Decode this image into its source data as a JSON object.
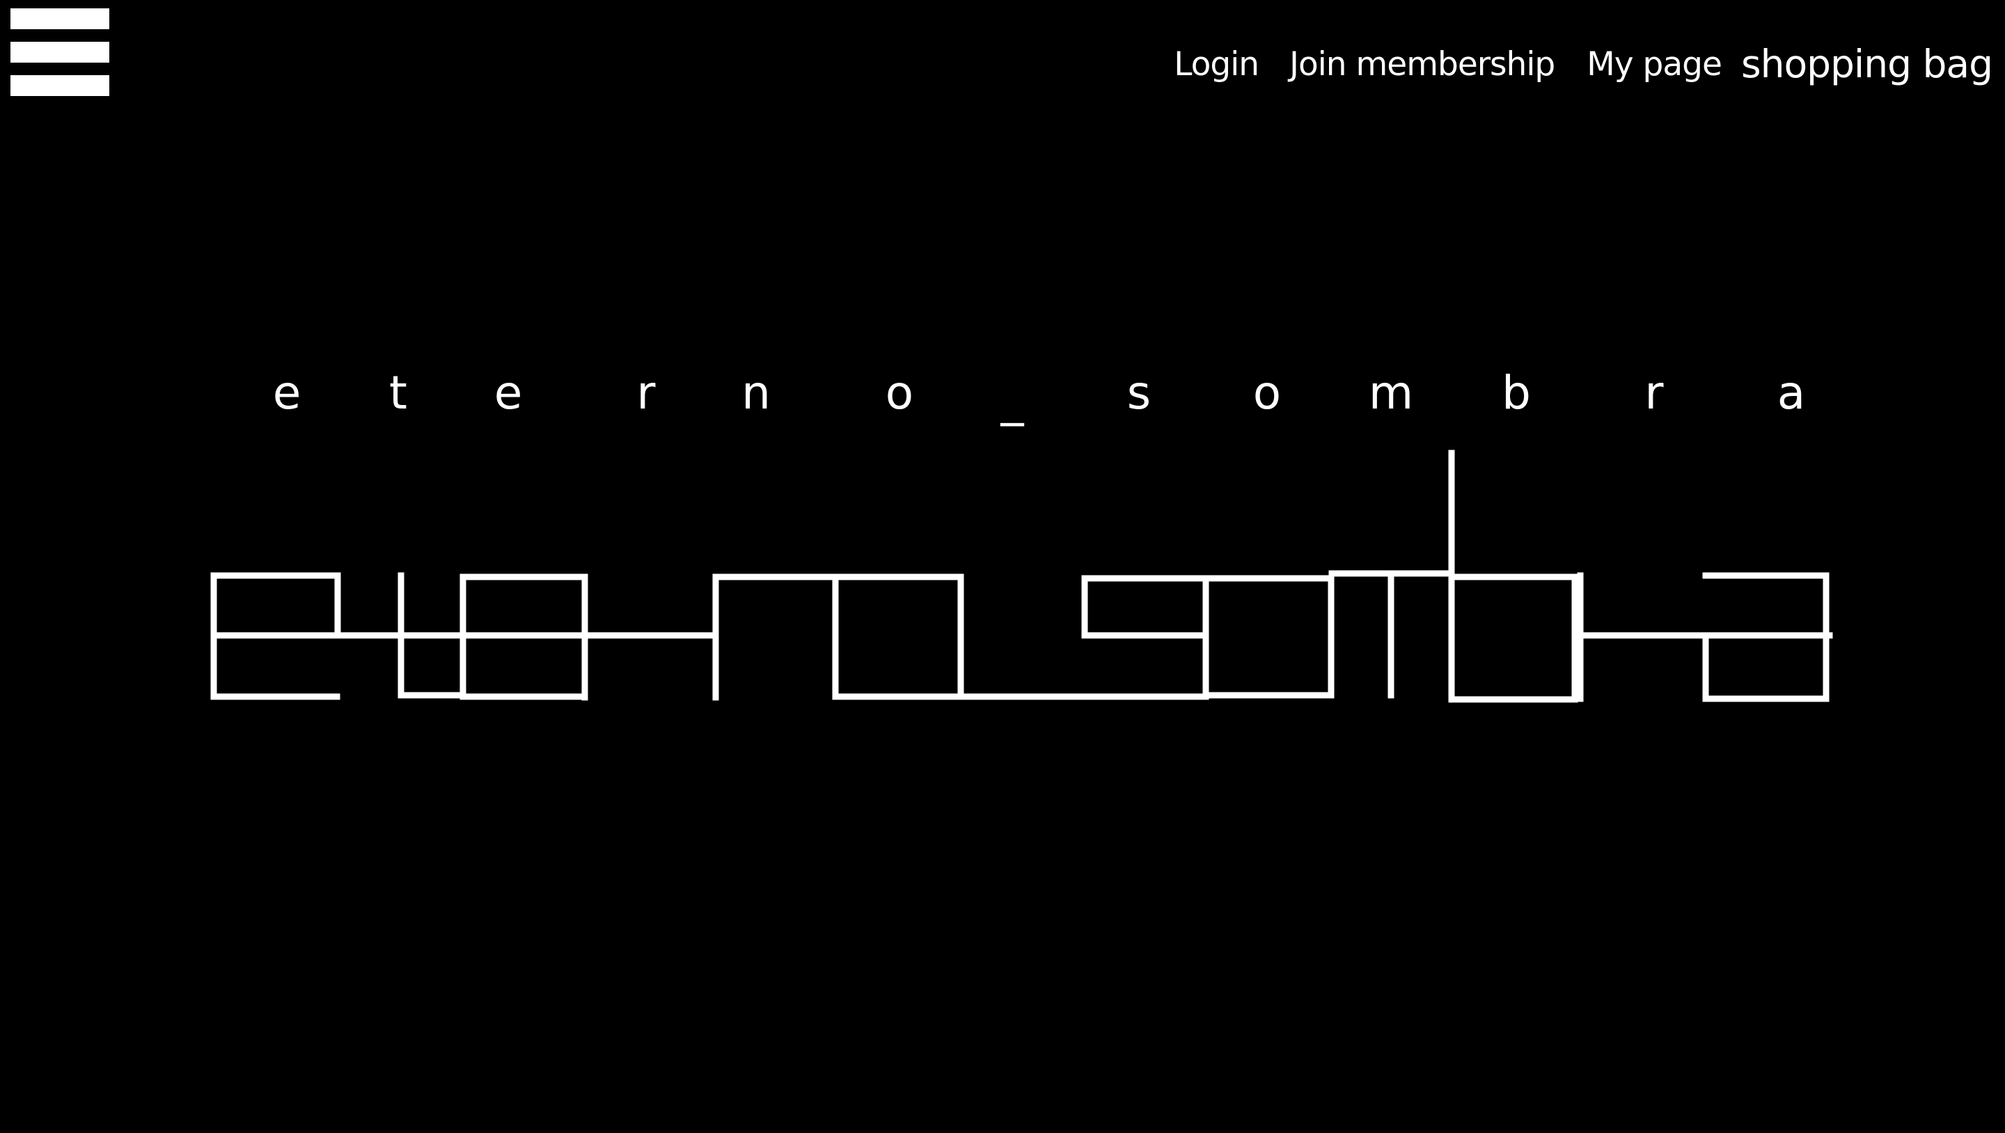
{
  "header": {
    "menu_icon": "hamburger-menu-icon",
    "nav": {
      "login": "Login",
      "join": "Join membership",
      "mypage": "My page",
      "bag": "shopping bag"
    }
  },
  "brand": {
    "letters": [
      "e",
      "t",
      "e",
      "r",
      "n",
      "o",
      "_",
      "s",
      "o",
      "m",
      "b",
      "r",
      "a"
    ],
    "logo_name": "eterno_sombra"
  },
  "colors": {
    "background": "#000000",
    "foreground": "#ffffff"
  }
}
